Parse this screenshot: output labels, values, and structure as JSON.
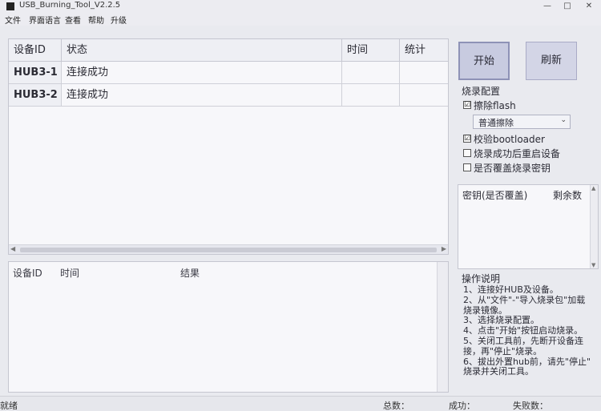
{
  "window": {
    "title": "USB_Burning_Tool_V2.2.5",
    "min": "—",
    "max": "□",
    "close": "✕"
  },
  "menu": [
    "文件",
    "界面语言",
    "查看",
    "帮助",
    "升级"
  ],
  "grid": {
    "headers": [
      "设备ID",
      "状态",
      "时间",
      "统计"
    ],
    "rows": [
      {
        "id": "HUB3-1",
        "status": "连接成功",
        "time": "",
        "count": ""
      },
      {
        "id": "HUB3-2",
        "status": "连接成功",
        "time": "",
        "count": ""
      }
    ]
  },
  "log": {
    "headers": [
      "设备ID",
      "时间",
      "结果"
    ]
  },
  "buttons": {
    "start": "开始",
    "refresh": "刷新"
  },
  "config": {
    "title": "烧录配置",
    "erase_flash": {
      "label": "擦除flash",
      "checked": true
    },
    "erase_mode": {
      "value": "普通擦除"
    },
    "verify_bootloader": {
      "label": "校验bootloader",
      "checked": true
    },
    "reboot_after": {
      "label": "烧录成功后重启设备",
      "checked": false
    },
    "overwrite_key": {
      "label": "是否覆盖烧录密钥",
      "checked": false
    }
  },
  "keys": {
    "headers": [
      "密钥(是否覆盖)",
      "剩余数"
    ]
  },
  "instructions": {
    "title": "操作说明",
    "lines": [
      "1、连接好HUB及设备。",
      "2、从\"文件\"-\"导入烧录包\"加载",
      "烧录镜像。",
      "3、选择烧录配置。",
      "4、点击\"开始\"按钮启动烧录。",
      "5、关闭工具前，先断开设备连",
      "接，再\"停止\"烧录。",
      "6、拔出外置hub前，请先\"停止\"",
      "烧录并关闭工具。"
    ]
  },
  "status": {
    "ready": "就绪",
    "total": "总数：",
    "success": "成功：",
    "fail": "失败数："
  },
  "icons": {
    "check": "☑",
    "unchecked": "☐",
    "dropdown": "chevron-down-icon"
  }
}
